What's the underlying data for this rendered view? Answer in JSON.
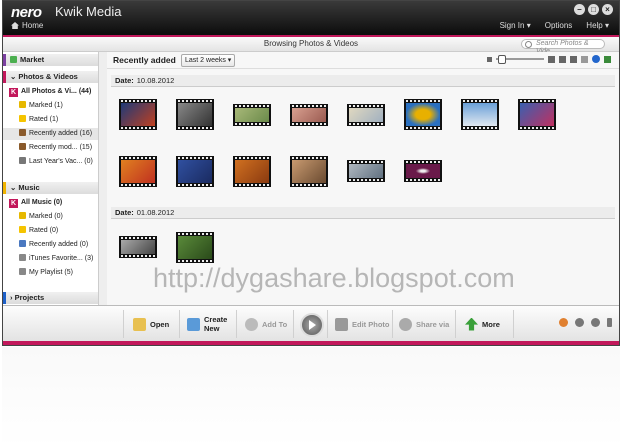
{
  "window": {
    "logo": "nero",
    "title": "Kwik Media",
    "home_label": "Home",
    "sign_in": "Sign In ▾",
    "options": "Options",
    "help": "Help ▾",
    "subtitle": "Browsing Photos & Videos",
    "search_placeholder": "Search Photos & Vide..."
  },
  "sidebar": {
    "market": "Market",
    "photos_header": "Photos & Videos",
    "photos_items": [
      "All Photos & Vi... (44)",
      "Marked (1)",
      "Rated (1)",
      "Recently added (16)",
      "Recently mod... (15)",
      "Last Year's Vac... (0)"
    ],
    "music_header": "Music",
    "music_items": [
      "All Music (0)",
      "Marked (0)",
      "Rated (0)",
      "Recently added (0)",
      "iTunes Favorite... (3)",
      "My Playlist (5)"
    ],
    "projects_header": "Projects"
  },
  "main": {
    "section_title": "Recently added",
    "range": "Last 2 weeks ▾",
    "date_label": "Date:",
    "group1_date": "10.08.2012",
    "group2_date": "01.08.2012"
  },
  "watermark": "http://dygashare.blogspot.com",
  "toolbar": {
    "open": "Open",
    "create": "Create New",
    "add_to": "Add To",
    "edit_photo": "Edit Photo",
    "share_via": "Share via",
    "more": "More"
  },
  "colors": {
    "accent": "#c2185b",
    "titlebar": "#1a1a1a"
  }
}
